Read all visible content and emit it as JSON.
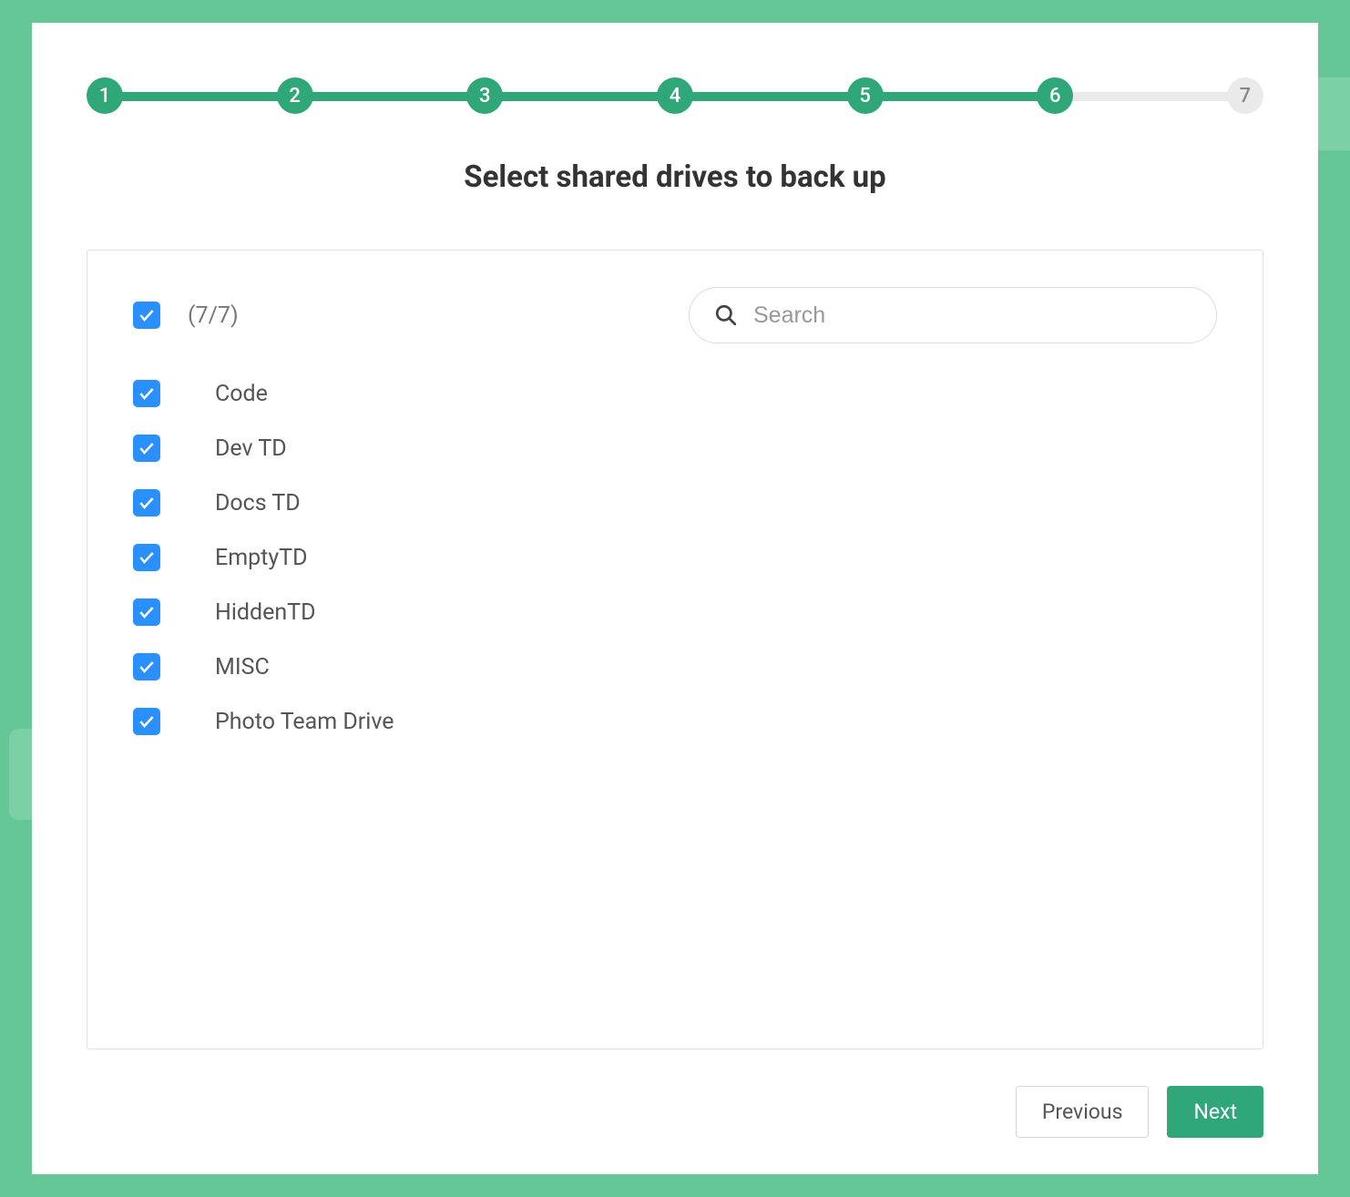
{
  "stepper": {
    "steps": [
      "1",
      "2",
      "3",
      "4",
      "5",
      "6",
      "7"
    ],
    "current_index": 5,
    "completed_count": 6,
    "total_count": 7
  },
  "title": "Select shared drives to back up",
  "selection": {
    "count_label": "(7/7)",
    "search_placeholder": "Search"
  },
  "drives": [
    {
      "label": "Code",
      "checked": true
    },
    {
      "label": "Dev TD",
      "checked": true
    },
    {
      "label": "Docs TD",
      "checked": true
    },
    {
      "label": "EmptyTD",
      "checked": true
    },
    {
      "label": "HiddenTD",
      "checked": true
    },
    {
      "label": "MISC",
      "checked": true
    },
    {
      "label": "Photo Team Drive",
      "checked": true
    }
  ],
  "buttons": {
    "previous": "Previous",
    "next": "Next"
  },
  "colors": {
    "accent_green": "#2fa779",
    "bg_green": "#66c796",
    "checkbox_blue": "#2b90ff"
  }
}
